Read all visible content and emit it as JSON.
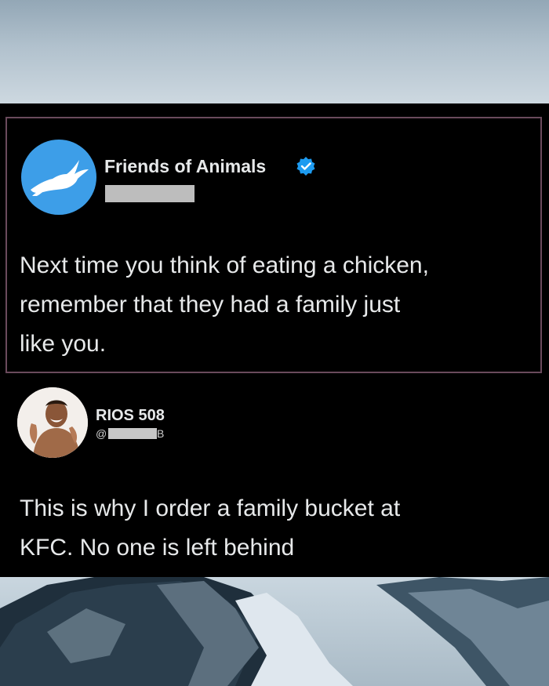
{
  "original_tweet": {
    "account_name": "Friends of Animals",
    "verified_icon": "verified-badge-icon",
    "avatar_icon": "hare-logo-icon",
    "text": "Next time you think of eating a chicken,\nremember that they had a family  just\nlike you.",
    "colors": {
      "avatar_bg": "#3d9ee8",
      "verified": "#1d9bf0",
      "frame_border": "#6a4a5c"
    }
  },
  "reply_tweet": {
    "account_name": "RIOS 508",
    "handle_prefix": "@",
    "handle_suffix": "B",
    "text": "This is why I order a family bucket at\nKFC. No one is left behind"
  }
}
